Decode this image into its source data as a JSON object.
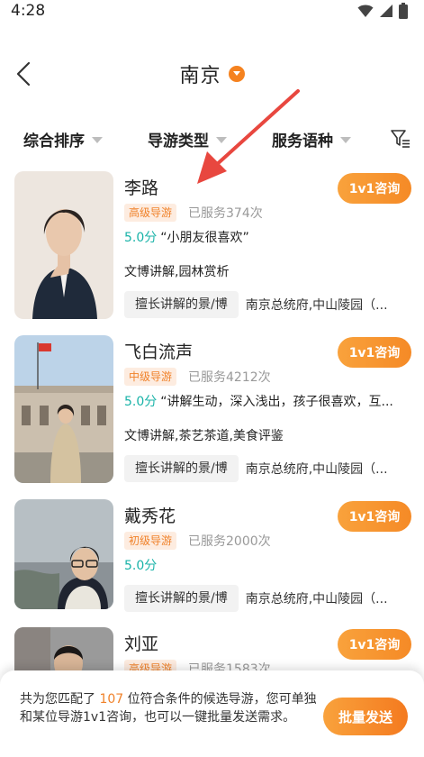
{
  "status_bar": {
    "time": "4:28"
  },
  "header": {
    "title": "南京"
  },
  "filters": [
    {
      "label": "综合排序"
    },
    {
      "label": "导游类型"
    },
    {
      "label": "服务语种"
    }
  ],
  "guides": [
    {
      "name": "李路",
      "level": "高级导游",
      "served": "已服务374次",
      "score": "5.0分",
      "review": "“小朋友很喜欢”",
      "skills": "文博讲解,园林赏析",
      "tag": "擅长讲解的景/博",
      "sites": "南京总统府,中山陵园（...",
      "consult": "1v1咨询"
    },
    {
      "name": "飞白流声",
      "level": "中级导游",
      "served": "已服务4212次",
      "score": "5.0分",
      "review": "“讲解生动，深入浅出，孩子很喜欢，互...",
      "skills": "文博讲解,茶艺茶道,美食评鉴",
      "tag": "擅长讲解的景/博",
      "sites": "南京总统府,中山陵园（...",
      "consult": "1v1咨询"
    },
    {
      "name": "戴秀花",
      "level": "初级导游",
      "served": "已服务2000次",
      "score": "5.0分",
      "review": "",
      "skills": "",
      "tag": "擅长讲解的景/博",
      "sites": "南京总统府,中山陵园（...",
      "consult": "1v1咨询"
    },
    {
      "name": "刘亚",
      "level": "高级导游",
      "served": "已服务1583次",
      "score": "",
      "review": "",
      "skills": "",
      "tag": "",
      "sites": "",
      "consult": "1v1咨询"
    }
  ],
  "bottom_bar": {
    "msg_prefix": "共为您匹配了 ",
    "count": "107",
    "msg_suffix": " 位符合条件的候选导游，您可单独和某位导游1v1咨询，也可以一键批量发送需求。",
    "batch_label": "批量发送"
  },
  "colors": {
    "accent": "#f58a26",
    "score": "#19b3a8",
    "annotation_arrow": "#e8473f"
  }
}
